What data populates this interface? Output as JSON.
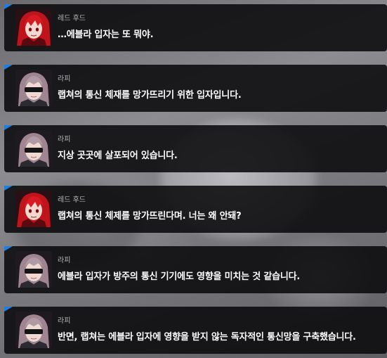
{
  "dialogue": [
    {
      "speaker": "레드 후드",
      "text": "…에블라 입자는 또 뭐야.",
      "portrait": "red-hood"
    },
    {
      "speaker": "라피",
      "text": "랩쳐의 통신 체재를 망가뜨리기 위한 입자입니다.",
      "portrait": "rapi"
    },
    {
      "speaker": "라피",
      "text": "지상 곳곳에 살포되어 있습니다.",
      "portrait": "rapi"
    },
    {
      "speaker": "레드 후드",
      "text": "랩쳐의 통신 체제를 망가뜨린다며. 너는 왜 안돼?",
      "portrait": "red-hood"
    },
    {
      "speaker": "라피",
      "text": "에블라 입자가 방주의 통신 기기에도 영향을 미치는 것 같습니다.",
      "portrait": "rapi"
    },
    {
      "speaker": "라피",
      "text": "반면, 랩쳐는 에블라 입자에 영향을 받지 않는 독자적인 통신망을 구축했습니다.",
      "portrait": "rapi"
    }
  ],
  "colors": {
    "accent": "#1d7fe0",
    "panel": "#0a0a0c",
    "speaker_text": "#b8b8bc",
    "dialogue_text": "#ffffff",
    "red_hood_hair": "#c0141c",
    "rapi_hair": "#9e8590"
  },
  "icons": {
    "red-hood": "red-hood-portrait-icon",
    "rapi": "rapi-portrait-icon"
  }
}
